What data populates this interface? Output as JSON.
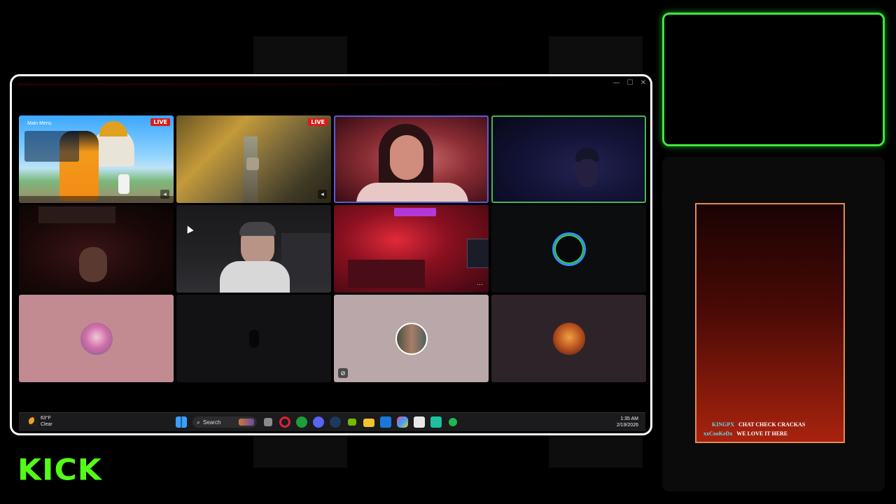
{
  "window": {
    "controls": [
      "—",
      "☐",
      "✕"
    ]
  },
  "tiles": [
    {
      "type": "game-stream",
      "live_label": "LIVE",
      "menu_title": "Main Menu"
    },
    {
      "type": "game-stream",
      "live_label": "LIVE"
    },
    {
      "type": "webcam",
      "border": "#5a5ad6"
    },
    {
      "type": "webcam",
      "border": "#46b846"
    },
    {
      "type": "webcam"
    },
    {
      "type": "webcam"
    },
    {
      "type": "webcam"
    },
    {
      "type": "avatar",
      "bg": "#0c0d0f"
    },
    {
      "type": "avatar",
      "bg": "#c28b91"
    },
    {
      "type": "avatar",
      "bg": "#121214"
    },
    {
      "type": "avatar",
      "bg": "#b9a7a9"
    },
    {
      "type": "avatar",
      "bg": "#2e2329"
    }
  ],
  "taskbar": {
    "weather_temp": "63°F",
    "weather_desc": "Clear",
    "search_label": "Search",
    "time": "1:35 AM",
    "date": "2/19/2026",
    "icons": [
      "windows-start-icon",
      "search-icon",
      "widgets-icon",
      "task-view-icon",
      "opera-icon",
      "xbox-icon",
      "discord-icon",
      "steam-icon",
      "nvidia-icon",
      "file-explorer-icon",
      "mail-icon",
      "copilot-icon",
      "store-icon",
      "game-app-icon",
      "spotify-icon"
    ]
  },
  "chat": {
    "messages": [
      {
        "user": "KINGPX",
        "text": "CHAT CHECK CRACKAS"
      },
      {
        "user": "xxCooKeDx",
        "text": "WE LOVE IT HERE"
      }
    ]
  },
  "brand": {
    "logo_text": "KICK",
    "accent": "#53fc18"
  }
}
